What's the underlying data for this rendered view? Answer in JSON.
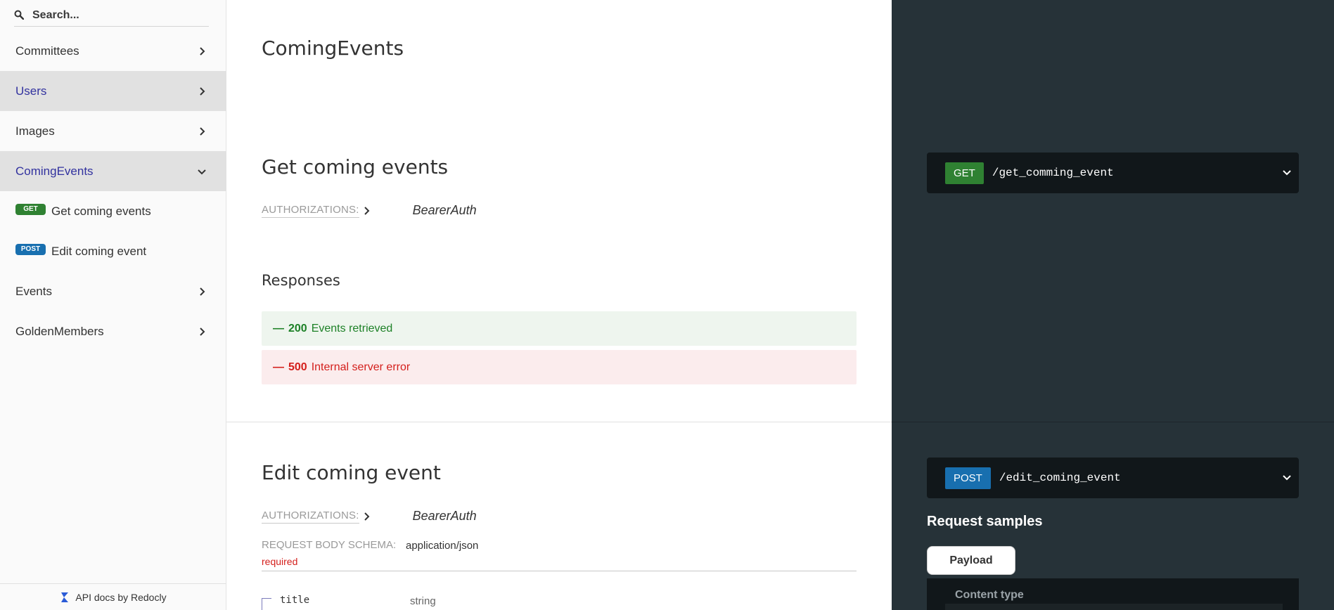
{
  "sidebar": {
    "search_placeholder": "Search...",
    "items": [
      {
        "label": "Committees"
      },
      {
        "label": "Users"
      },
      {
        "label": "Images"
      },
      {
        "label": "ComingEvents"
      },
      {
        "label": "Events"
      },
      {
        "label": "GoldenMembers"
      }
    ],
    "sub_items": [
      {
        "method": "GET",
        "label": "Get coming events"
      },
      {
        "method": "POST",
        "label": "Edit coming event"
      }
    ],
    "footer": "API docs by Redocly"
  },
  "main": {
    "section_title": "ComingEvents",
    "operations": [
      {
        "title": "Get coming events",
        "auth_label": "AUTHORIZATIONS:",
        "auth_value": "BearerAuth",
        "responses_title": "Responses",
        "responses": [
          {
            "dash": "—",
            "code": "200",
            "text": "Events retrieved"
          },
          {
            "dash": "—",
            "code": "500",
            "text": "Internal server error"
          }
        ]
      },
      {
        "title": "Edit coming event",
        "auth_label": "AUTHORIZATIONS:",
        "auth_value": "BearerAuth",
        "schema_label": "REQUEST BODY SCHEMA:",
        "schema_value": "application/json",
        "schema_required": "required",
        "fields": [
          {
            "name": "title",
            "type": "string"
          }
        ]
      }
    ]
  },
  "right_panel": {
    "endpoints": [
      {
        "method": "GET",
        "path": "/get_comming_event"
      },
      {
        "method": "POST",
        "path": "/edit_coming_event"
      }
    ],
    "request_samples_title": "Request samples",
    "payload_tab": "Payload",
    "content_type_label": "Content type"
  },
  "colors": {
    "get": "#2f8132",
    "post": "#186faf",
    "active_menu_text": "#32329f",
    "right_bg": "#263238",
    "success": "#1d8127",
    "error": "#d41f1c"
  }
}
